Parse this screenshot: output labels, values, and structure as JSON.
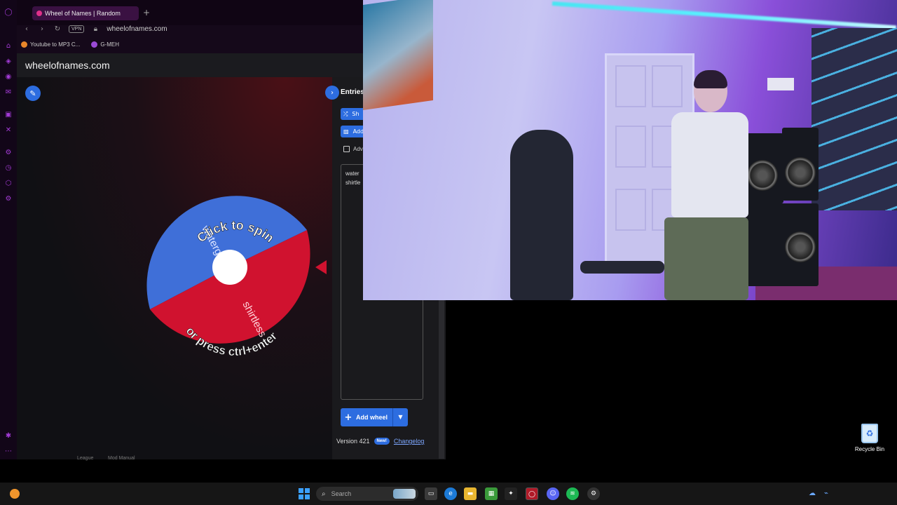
{
  "browser": {
    "tab_title": "Wheel of Names | Random",
    "new_tab_symbol": "+",
    "vpn_label": "VPN",
    "url": "wheelofnames.com",
    "bookmarks": [
      {
        "label": "Youtube to MP3 C...",
        "color": "#e8862a"
      },
      {
        "label": "G-MEH",
        "color": "#9b4bd6"
      }
    ],
    "accent_color": "#a33bd6"
  },
  "site": {
    "header_title": "wheelofnames.com",
    "wheel": {
      "center_text_top": "Click to spin",
      "center_text_bottom": "or press ctrl+enter",
      "segments": [
        {
          "label": "watergun",
          "color": "#3f6fd8"
        },
        {
          "label": "shirtless",
          "color": "#d0122f"
        }
      ],
      "pointer_color": "#d0122f"
    },
    "panel": {
      "entries_tab": "Entries",
      "shuffle_label": "Sh",
      "add_image_label": "Add",
      "advanced_label": "Adv",
      "entries": [
        "water",
        "shirtle"
      ],
      "add_wheel_label": "Add wheel",
      "version_label": "Version 421",
      "new_badge": "New!",
      "changelog_label": "Changelog"
    },
    "below_text_1": "League",
    "below_text_2": "Mod Manual"
  },
  "desktop": {
    "recycle_bin_label": "Recycle Bin"
  },
  "taskbar": {
    "search_placeholder": "Search"
  }
}
